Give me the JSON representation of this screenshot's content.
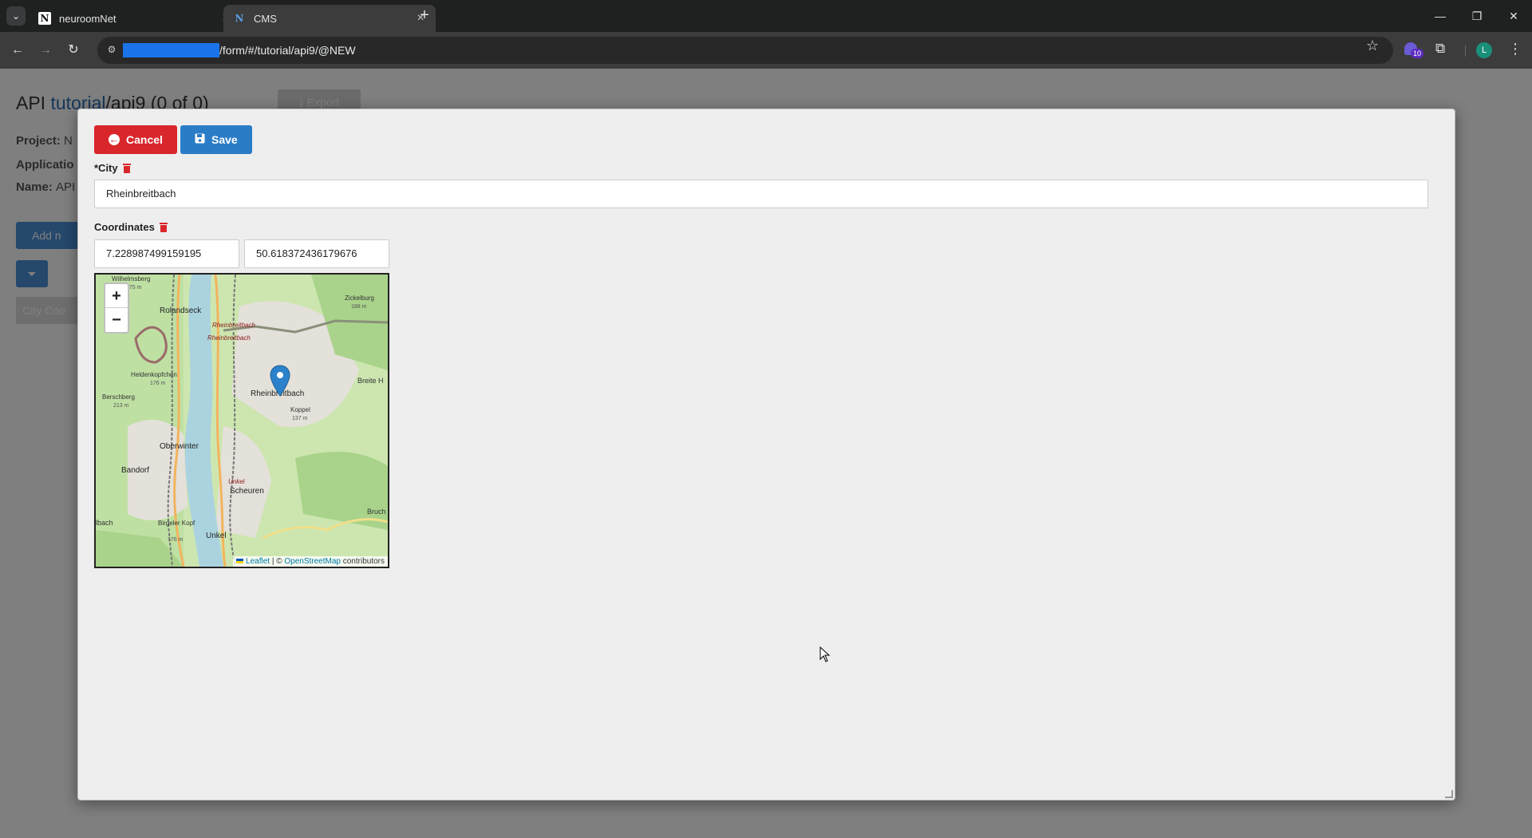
{
  "browser": {
    "tabs": [
      {
        "title": "neuroomNet",
        "favicon": "N"
      },
      {
        "title": "CMS",
        "favicon": "N"
      }
    ],
    "url_path": "/form/#/tutorial/api9/@NEW",
    "extension_badge": "10",
    "profile_initial": "L"
  },
  "background_page": {
    "title_prefix": "API ",
    "title_link": "tutorial",
    "title_suffix": "/api9 (0 of 0)",
    "export_label": "Export",
    "project_label": "Project:",
    "project_value": "N",
    "application_label": "Applicatio",
    "name_label": "Name:",
    "name_value": "API",
    "add_label": "Add n",
    "table_header": "City   Coo"
  },
  "form": {
    "cancel_label": "Cancel",
    "save_label": "Save",
    "city_label": "*City",
    "city_value": "Rheinbreitbach",
    "coordinates_label": "Coordinates",
    "longitude_value": "7.228987499159195",
    "latitude_value": "50.618372436179676"
  },
  "map": {
    "zoom_in": "+",
    "zoom_out": "−",
    "attribution_leaflet": "Leaflet",
    "attribution_sep": " | © ",
    "attribution_osm": "OpenStreetMap",
    "attribution_suffix": " contributors",
    "places": [
      {
        "name": "Wilhelmsberg",
        "elev": "175 m"
      },
      {
        "name": "Rolandseck"
      },
      {
        "name": "Rheinbreitbach"
      },
      {
        "name": "Rheinbreitbach"
      },
      {
        "name": "Zickelburg",
        "elev": "188 m"
      },
      {
        "name": "Heldenkopfchen",
        "elev": "176 m"
      },
      {
        "name": "Berschberg",
        "elev": "213 m"
      },
      {
        "name": "Rheinbreitbach"
      },
      {
        "name": "Breite H"
      },
      {
        "name": "Koppel",
        "elev": "137 m"
      },
      {
        "name": "Oberwinter"
      },
      {
        "name": "Bandorf"
      },
      {
        "name": "Unkel"
      },
      {
        "name": "Scheuren"
      },
      {
        "name": "lbach"
      },
      {
        "name": "Birgeler Kopf",
        "elev": "176 m"
      },
      {
        "name": "Unkel"
      },
      {
        "name": "Bruch"
      }
    ]
  }
}
